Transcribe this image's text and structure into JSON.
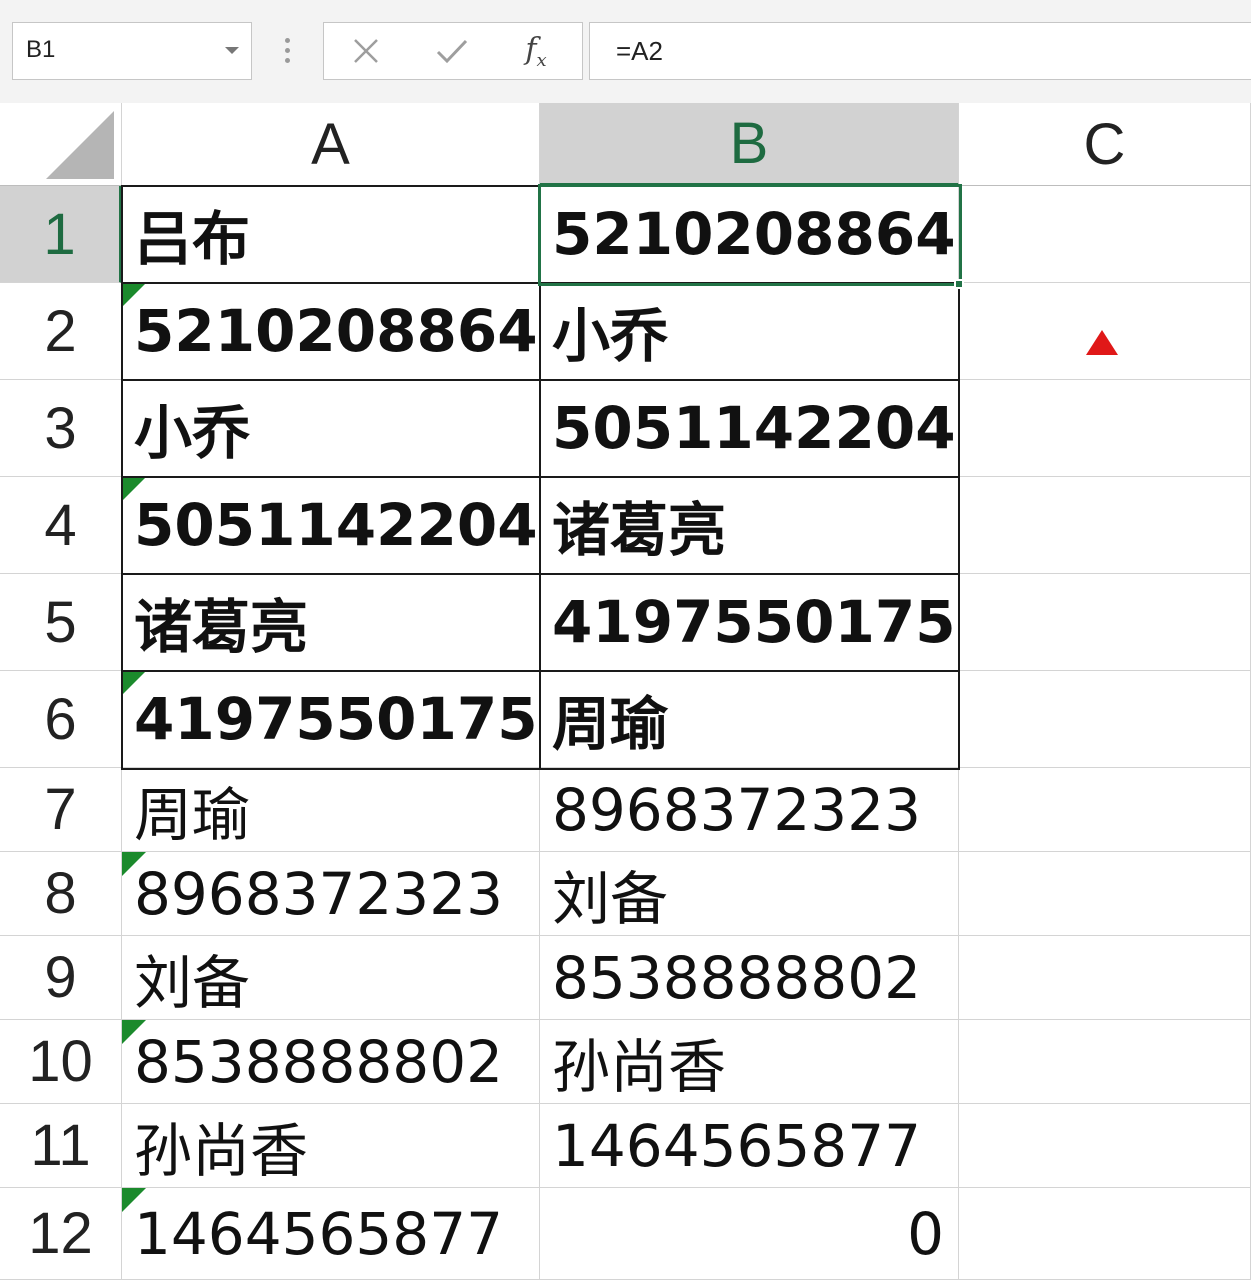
{
  "formula_bar": {
    "name_box": "B1",
    "formula": "=A2"
  },
  "columns": [
    "A",
    "B",
    "C"
  ],
  "rows": [
    "1",
    "2",
    "3",
    "4",
    "5",
    "6",
    "7",
    "8",
    "9",
    "10",
    "11",
    "12"
  ],
  "cells": {
    "A": [
      "吕布",
      "5210208864",
      "小乔",
      "5051142204",
      "诸葛亮",
      "4197550175",
      "周瑜",
      "8968372323",
      "刘备",
      "8538888802",
      "孙尚香",
      "1464565877"
    ],
    "B": [
      "5210208864",
      "小乔",
      "5051142204",
      "诸葛亮",
      "4197550175",
      "周瑜",
      "8968372323",
      "刘备",
      "8538888802",
      "孙尚香",
      "1464565877",
      "0"
    ]
  },
  "colors": {
    "selection": "#217346",
    "text_number_indicator": "#1b8a2c",
    "marker": "#e01818"
  },
  "icons": [
    "cancel-icon",
    "enter-icon",
    "function-icon",
    "dropdown-caret-icon",
    "select-all-icon",
    "red-triangle-marker"
  ]
}
